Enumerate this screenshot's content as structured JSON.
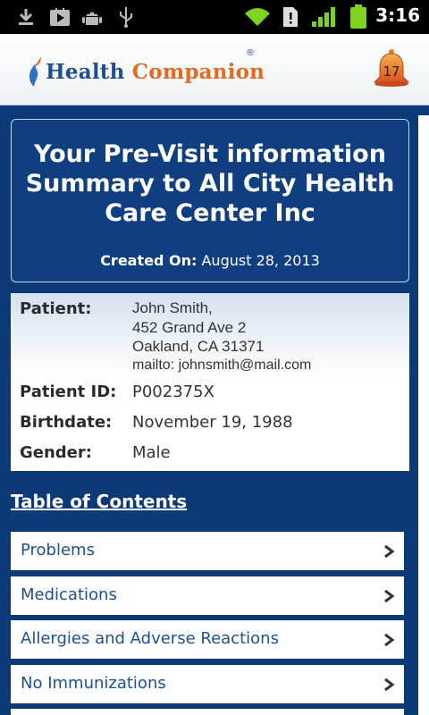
{
  "status_bar": {
    "time": "3:16",
    "icons": [
      "download-icon",
      "play-store-icon",
      "android-icon",
      "usb-icon",
      "wifi-icon",
      "sim-alert-icon",
      "signal-icon",
      "battery-icon"
    ]
  },
  "header": {
    "brand_word1": "Health",
    "brand_word2": "Companion",
    "brand_mark": "®",
    "notification_count": "17",
    "colors": {
      "brand_blue": "#1d4f91",
      "brand_orange": "#e36a1f"
    }
  },
  "summary": {
    "title": "Your Pre-Visit information Summary to All City Health Care Center Inc",
    "created_label": "Created On:",
    "created_value": "August 28, 2013"
  },
  "patient": {
    "patient_label": "Patient:",
    "address_lines": [
      "John Smith,",
      "452 Grand Ave 2",
      "Oakland, CA 31371",
      "mailto: johnsmith@mail.com"
    ],
    "id_label": "Patient ID:",
    "id_value": "P002375X",
    "birthdate_label": "Birthdate:",
    "birthdate_value": "November 19, 1988",
    "gender_label": "Gender:",
    "gender_value": "Male"
  },
  "toc": {
    "title": "Table of Contents",
    "items": [
      {
        "label": "Problems"
      },
      {
        "label": "Medications"
      },
      {
        "label": "Allergies and Adverse Reactions"
      },
      {
        "label": "No Immunizations"
      }
    ]
  },
  "colors": {
    "page_background": "#0c3a78",
    "link_text": "#1d4f91"
  }
}
